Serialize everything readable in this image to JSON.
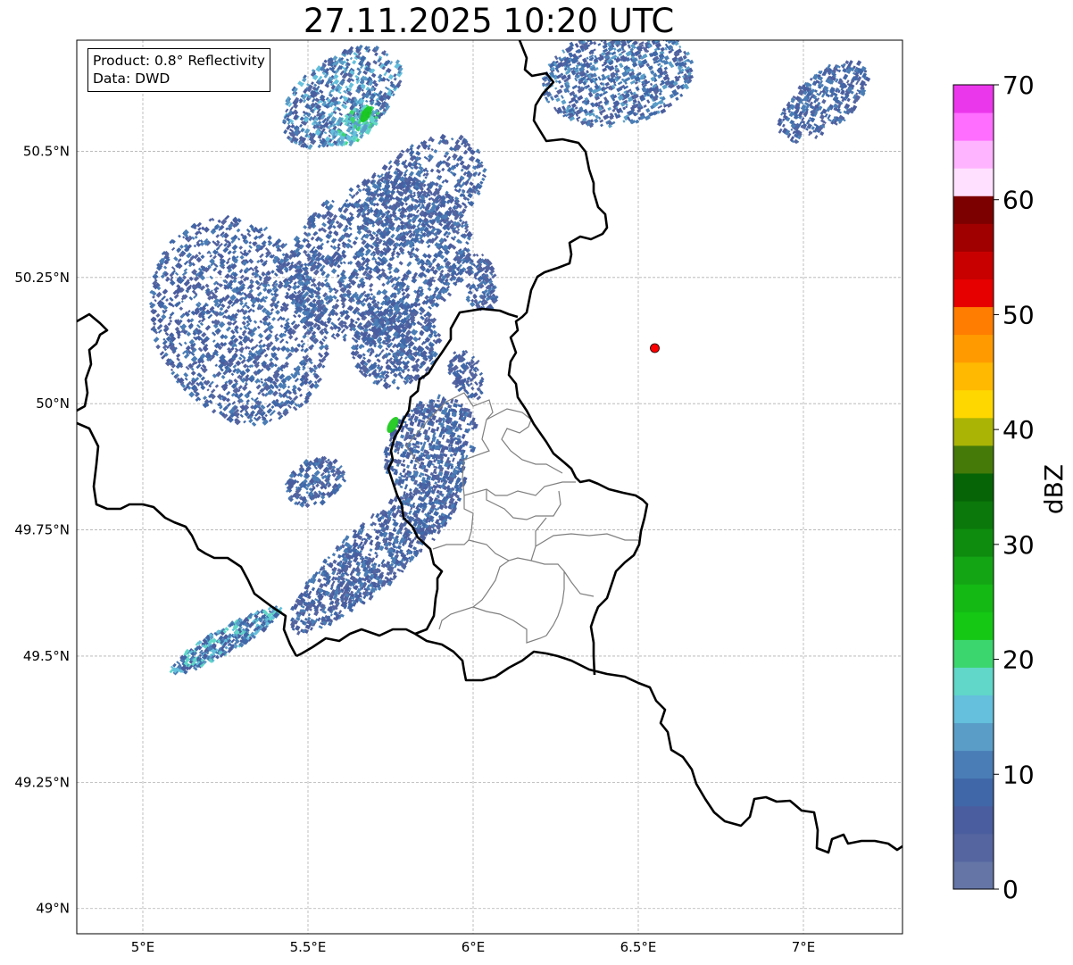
{
  "title": "27.11.2025 10:20 UTC",
  "info_box": {
    "product": "Product: 0.8° Reflectivity",
    "data": "Data: DWD"
  },
  "map": {
    "extent": {
      "lon": [
        4.8,
        7.3
      ],
      "lat": [
        48.95,
        50.72
      ]
    },
    "lon_ticks": [
      {
        "value": 5.0,
        "label": "5°E"
      },
      {
        "value": 5.5,
        "label": "5.5°E"
      },
      {
        "value": 6.0,
        "label": "6°E"
      },
      {
        "value": 6.5,
        "label": "6.5°E"
      },
      {
        "value": 7.0,
        "label": "7°E"
      }
    ],
    "lat_ticks": [
      {
        "value": 50.5,
        "label": "50.5°N"
      },
      {
        "value": 50.25,
        "label": "50.25°N"
      },
      {
        "value": 50.0,
        "label": "50°N"
      },
      {
        "value": 49.75,
        "label": "49.75°N"
      },
      {
        "value": 49.5,
        "label": "49.5°N"
      },
      {
        "value": 49.25,
        "label": "49.25°N"
      },
      {
        "value": 49.0,
        "label": "49°N"
      }
    ],
    "radar_site": {
      "lon": 6.55,
      "lat": 50.11,
      "color": "#ff0000"
    }
  },
  "colorbar": {
    "label": "dBZ",
    "min": 0,
    "max": 70,
    "ticks": [
      "0",
      "10",
      "20",
      "30",
      "40",
      "50",
      "60",
      "70"
    ],
    "colors": [
      "#6475a6",
      "#5565a0",
      "#4a5d9e",
      "#4068a8",
      "#4a7db5",
      "#5a9ec8",
      "#64c0dc",
      "#60d7c8",
      "#3cd66e",
      "#14c814",
      "#14b914",
      "#14a514",
      "#0e8c0e",
      "#0a780a",
      "#066406",
      "#457a09",
      "#aab405",
      "#ffd700",
      "#ffb900",
      "#ff9b00",
      "#ff7d00",
      "#e60000",
      "#c80000",
      "#a00000",
      "#7d0000",
      "#ffe1ff",
      "#ffb4ff",
      "#ff6eff",
      "#eb37eb"
    ]
  },
  "colors": {
    "border": "#000000",
    "admin": "#7f7f7f",
    "grid": "#b0b0b0"
  }
}
